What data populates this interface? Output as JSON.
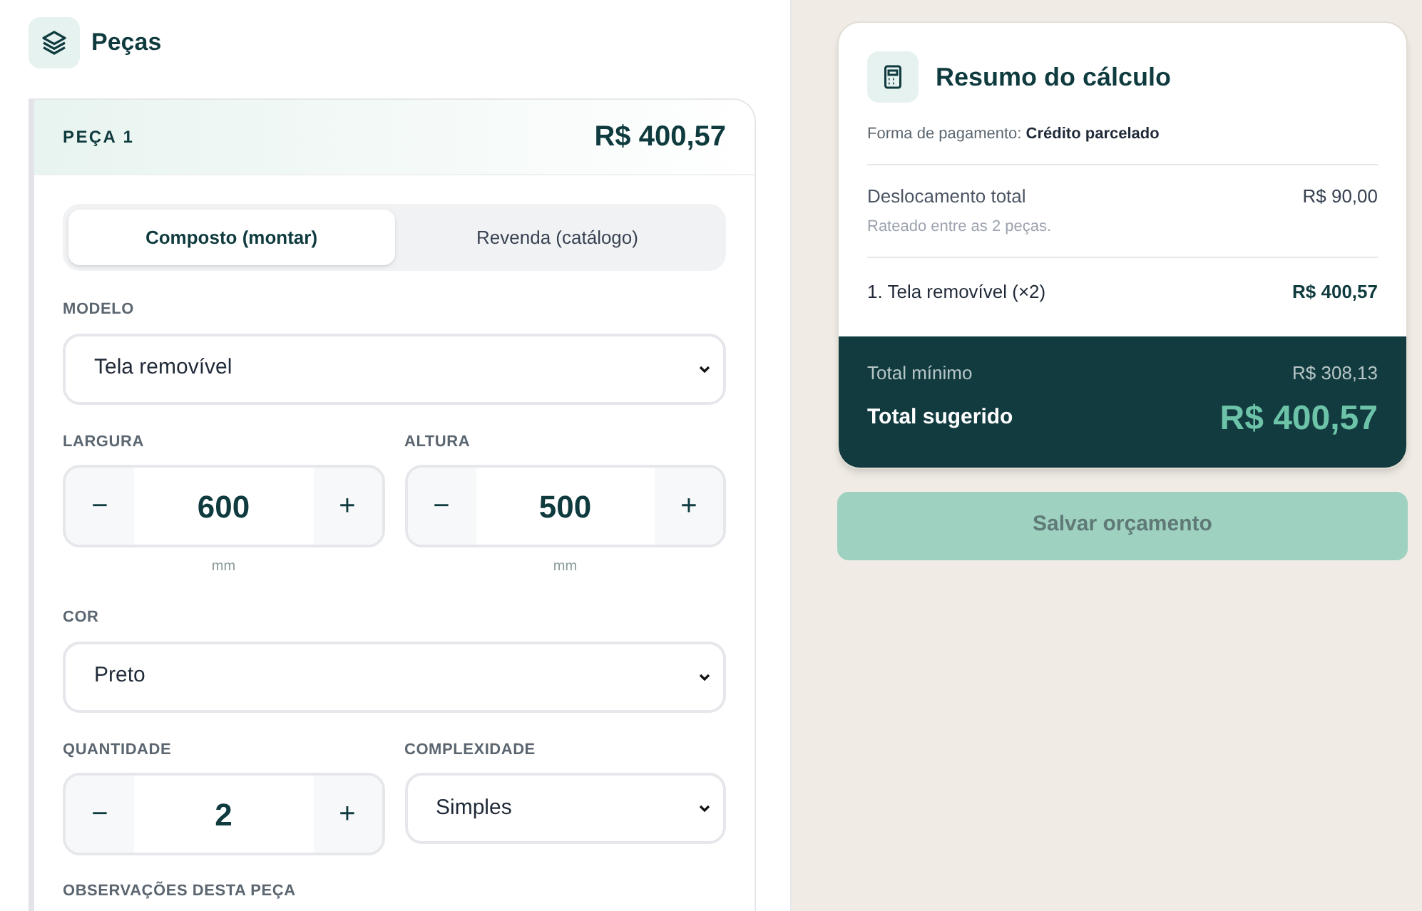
{
  "section": {
    "title": "Peças"
  },
  "piece": {
    "label": "PEÇA 1",
    "price": "R$ 400,57",
    "tabs": [
      {
        "label": "Composto (montar)",
        "selected": true
      },
      {
        "label": "Revenda (catálogo)",
        "selected": false
      }
    ],
    "model": {
      "label": "MODELO",
      "value": "Tela removível"
    },
    "width": {
      "label": "LARGURA",
      "value": "600",
      "unit": "mm",
      "minus": "−",
      "plus": "+"
    },
    "height": {
      "label": "ALTURA",
      "value": "500",
      "unit": "mm",
      "minus": "−",
      "plus": "+"
    },
    "color": {
      "label": "COR",
      "value": "Preto"
    },
    "quantity": {
      "label": "QUANTIDADE",
      "value": "2",
      "minus": "−",
      "plus": "+"
    },
    "complexity": {
      "label": "COMPLEXIDADE",
      "value": "Simples"
    },
    "notes": {
      "label": "OBSERVAÇÕES DESTA PEÇA"
    }
  },
  "summary": {
    "title": "Resumo do cálculo",
    "payment_label": "Forma de pagamento:",
    "payment_value": "Crédito parcelado",
    "travel_label": "Deslocamento total",
    "travel_value": "R$ 90,00",
    "travel_note": "Rateado entre as 2 peças.",
    "items": [
      {
        "label": "1. Tela removível (×2)",
        "value": "R$ 400,57"
      }
    ],
    "min_label": "Total mínimo",
    "min_value": "R$ 308,13",
    "suggested_label": "Total sugerido",
    "suggested_value": "R$ 400,57"
  },
  "save_button": {
    "label": "Salvar orçamento",
    "disabled": true
  }
}
